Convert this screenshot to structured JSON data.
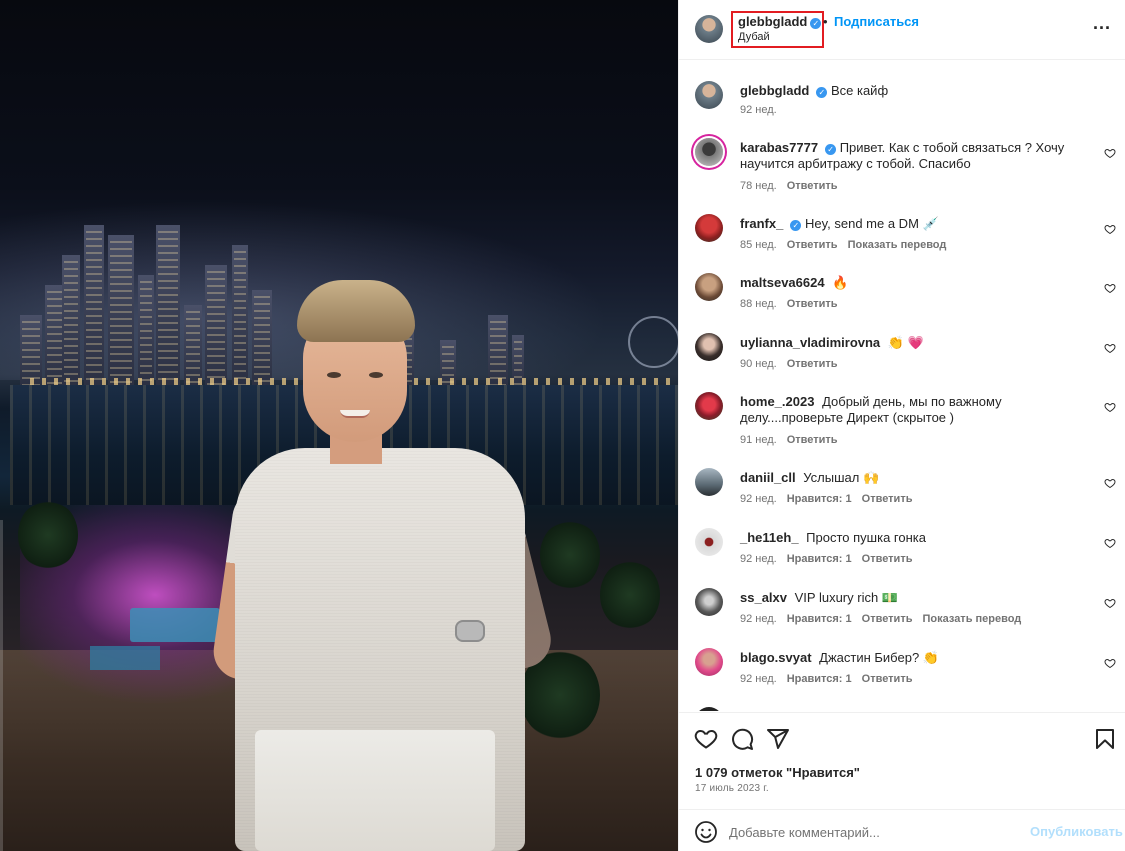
{
  "post": {
    "username": "glebbgladd",
    "follow_label": "Подписаться",
    "dot": "•",
    "location": "Дубай",
    "more_label": "..."
  },
  "comments": [
    {
      "user": "glebbgladd",
      "verified": true,
      "text": "Все кайф",
      "time": "92 нед.",
      "likes": "",
      "reply": "",
      "translate": ""
    },
    {
      "user": "karabas7777",
      "verified": true,
      "text": "Привет. Как с тобой связаться ? Хочу научится арбитражу с тобой. Спасибо",
      "time": "78 нед.",
      "likes": "",
      "reply": "Ответить",
      "translate": ""
    },
    {
      "user": "franfx_",
      "verified": true,
      "text": "Hey, send me a DM 💉",
      "time": "85 нед.",
      "likes": "",
      "reply": "Ответить",
      "translate": "Показать перевод"
    },
    {
      "user": "maltseva6624",
      "verified": false,
      "text": "🔥",
      "time": "88 нед.",
      "likes": "",
      "reply": "Ответить",
      "translate": ""
    },
    {
      "user": "uylianna_vladimirovna",
      "verified": false,
      "text": "👏 💗",
      "time": "90 нед.",
      "likes": "",
      "reply": "Ответить",
      "translate": ""
    },
    {
      "user": "home_.2023",
      "verified": false,
      "text": "Добрый день, мы по важному делу....проверьте Директ (скрытое )",
      "time": "91 нед.",
      "likes": "",
      "reply": "Ответить",
      "translate": ""
    },
    {
      "user": "daniil_cll",
      "verified": false,
      "text": "Услышал 🙌",
      "time": "92 нед.",
      "likes": "Нравится: 1",
      "reply": "Ответить",
      "translate": ""
    },
    {
      "user": "_he11eh_",
      "verified": false,
      "text": "Просто пушка гонка",
      "time": "92 нед.",
      "likes": "Нравится: 1",
      "reply": "Ответить",
      "translate": ""
    },
    {
      "user": "ss_alxv",
      "verified": false,
      "text": "VIP luxury rich 💵",
      "time": "92 нед.",
      "likes": "Нравится: 1",
      "reply": "Ответить",
      "translate": "Показать перевод"
    },
    {
      "user": "blago.svyat",
      "verified": false,
      "text": "Джастин Бибер? 👏",
      "time": "92 нед.",
      "likes": "Нравится: 1",
      "reply": "Ответить",
      "translate": ""
    }
  ],
  "footer": {
    "likes_text": "1 079 отметок \"Нравится\"",
    "date": "17 июль 2023 г.",
    "comment_placeholder": "Добавьте комментарий...",
    "publish_label": "Опубликовать"
  },
  "colors": {
    "accent_blue": "#0095f6",
    "verified_blue": "#3897f0",
    "highlight_red": "#e21c21",
    "muted_text": "#737373"
  },
  "icons": [
    "verified-badge-icon",
    "more-options-icon",
    "heart-icon",
    "comment-icon",
    "share-icon",
    "bookmark-icon",
    "emoji-icon"
  ]
}
